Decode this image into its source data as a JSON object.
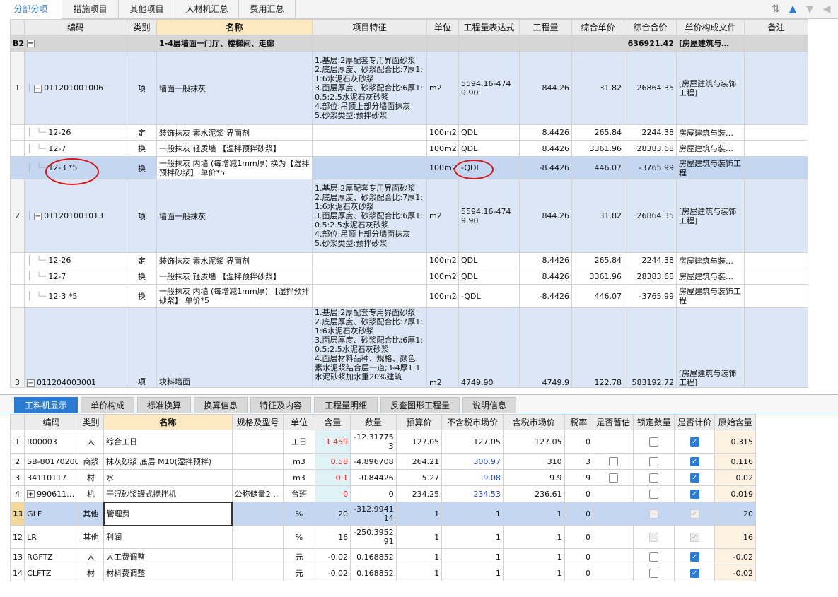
{
  "tabs": [
    "分部分项",
    "措施项目",
    "其他项目",
    "人材机汇总",
    "费用汇总"
  ],
  "top_headers": [
    "编码",
    "类别",
    "名称",
    "项目特征",
    "单位",
    "工程量表达式",
    "工程量",
    "综合单价",
    "综合合价",
    "单价构成文件",
    "备注"
  ],
  "group": {
    "no": "B2",
    "name": "1-4层墙面一门厅、楼梯间、走廊",
    "total": "636921.42",
    "file": "[房屋建筑与…"
  },
  "rows": [
    {
      "no": "1",
      "code": "011201001006",
      "type": "项",
      "name": "墙面一般抹灰",
      "feature": "1.基层:2厚配套专用界面砂浆\n2.底层厚度、砂浆配合比:7厚1:1:6水泥石灰砂浆\n3.面层厚度、砂浆配合比:6厚1:0.5:2.5水泥石灰砂浆\n4.部位:吊顶上部分墙面抹灰\n5.砂浆类型:预拌砂浆",
      "unit": "m2",
      "expr": "5594.16-4749.90",
      "qty": "844.26",
      "price": "31.82",
      "total": "26864.35",
      "file": "[房屋建筑与装饰工程]"
    },
    {
      "code": "12-26",
      "type": "定",
      "name": "装饰抹灰 素水泥浆 界面剂",
      "unit": "100m2",
      "expr": "QDL",
      "qty": "8.4426",
      "price": "265.84",
      "total": "2244.38",
      "file": "房屋建筑与装…"
    },
    {
      "code": "12-7",
      "type": "换",
      "name": "一般抹灰 轻质墙 【湿拌预拌砂浆】",
      "unit": "100m2",
      "expr": "QDL",
      "qty": "8.4426",
      "price": "3361.96",
      "total": "28383.68",
      "file": "房屋建筑与装…"
    },
    {
      "code": "12-3 *5",
      "type": "换",
      "name": "一般抹灰 内墙 (每增减1mm厚) 换为【湿拌预拌砂浆】 单价*5",
      "unit": "100m2",
      "expr": "-QDL",
      "qty": "-8.4426",
      "price": "446.07",
      "total": "-3765.99",
      "file": "房屋建筑与装饰工程"
    },
    {
      "no": "2",
      "code": "011201001013",
      "type": "项",
      "name": "墙面一般抹灰",
      "feature": "1.基层:2厚配套专用界面砂浆\n2.底层厚度、砂浆配合比:7厚1:1:6水泥石灰砂浆\n3.面层厚度、砂浆配合比:6厚1:0.5:2.5水泥石灰砂浆\n4.部位:吊顶上部分墙面抹灰\n5.砂浆类型:预拌砂浆",
      "unit": "m2",
      "expr": "5594.16-4749.90",
      "qty": "844.26",
      "price": "31.82",
      "total": "26864.35",
      "file": "[房屋建筑与装饰工程]"
    },
    {
      "code": "12-26",
      "type": "定",
      "name": "装饰抹灰 素水泥浆 界面剂",
      "unit": "100m2",
      "expr": "QDL",
      "qty": "8.4426",
      "price": "265.84",
      "total": "2244.38",
      "file": "房屋建筑与装…"
    },
    {
      "code": "12-7",
      "type": "换",
      "name": "一般抹灰 轻质墙 【湿拌预拌砂浆】",
      "unit": "100m2",
      "expr": "QDL",
      "qty": "8.4426",
      "price": "3361.96",
      "total": "28383.68",
      "file": "房屋建筑与装…"
    },
    {
      "code": "12-3 *5",
      "type": "换",
      "name": "一般抹灰 内墙 (每增减1mm厚) 【湿拌预拌砂浆】 单价*5",
      "unit": "100m2",
      "expr": "-QDL",
      "qty": "-8.4426",
      "price": "446.07",
      "total": "-3765.99",
      "file": "房屋建筑与装饰工程"
    },
    {
      "no": "3",
      "code": "011204003001",
      "type": "项",
      "name": "块料墙面",
      "feature": "1.基层:2厚配套专用界面砂浆\n2.底层厚度、砂浆配合比:7厚1:1:6水泥石灰砂浆\n3.面层厚度、砂浆配合比:6厚1:0.5:2.5水泥石灰砂浆\n4.面层材料品种、规格、颜色:素水泥浆结合层一道;3-4厚1:1水泥砂浆加水重20%建筑",
      "unit": "m2",
      "expr": "4749.90",
      "qty": "4749.9",
      "price": "122.78",
      "total": "583192.72",
      "file": "[房屋建筑与装饰工程]"
    }
  ],
  "sub_tabs": [
    "工料机显示",
    "单价构成",
    "标准换算",
    "换算信息",
    "特征及内容",
    "工程量明细",
    "反查图形工程量",
    "说明信息"
  ],
  "bot_headers": [
    "编码",
    "类别",
    "名称",
    "规格及型号",
    "单位",
    "含量",
    "数量",
    "预算价",
    "不含税市场价",
    "含税市场价",
    "税率",
    "是否暂估",
    "锁定数量",
    "是否计价",
    "原始含量"
  ],
  "bot_rows": [
    {
      "no": "1",
      "code": "R00003",
      "type": "人",
      "name": "综合工日",
      "spec": "",
      "unit": "工日",
      "content": "1.459",
      "num": "-12.317753",
      "budget": "127.05",
      "mkt": "127.05",
      "mkttax": "127.05",
      "tax": "0",
      "orig": "0.315"
    },
    {
      "no": "2",
      "code": "SB-80170200",
      "type": "商浆",
      "name": "抹灰砂浆 底层 M10(湿拌预拌)",
      "spec": "",
      "unit": "m3",
      "content": "0.58",
      "num": "-4.896708",
      "budget": "264.21",
      "mkt": "300.97",
      "mkttax": "310",
      "tax": "3",
      "orig": "0.116"
    },
    {
      "no": "3",
      "code": "34110117",
      "type": "材",
      "name": "水",
      "spec": "",
      "unit": "m3",
      "content": "0.1",
      "num": "-0.84426",
      "budget": "5.27",
      "mkt": "9.08",
      "mkttax": "9.9",
      "tax": "9",
      "orig": "0.02"
    },
    {
      "no": "4",
      "code": "990611…",
      "type": "机",
      "name": "干混砂浆罐式搅拌机",
      "spec": "公称储量2…",
      "unit": "台班",
      "content": "0",
      "num": "0",
      "budget": "234.25",
      "mkt": "234.53",
      "mkttax": "236.61",
      "tax": "0",
      "orig": "0.019"
    },
    {
      "no": "11",
      "code": "GLF",
      "type": "其他",
      "name": "管理费",
      "spec": "",
      "unit": "%",
      "content": "20",
      "num": "-312.994114",
      "budget": "1",
      "mkt": "1",
      "mkttax": "1",
      "tax": "0",
      "orig": "20"
    },
    {
      "no": "12",
      "code": "LR",
      "type": "其他",
      "name": "利润",
      "spec": "",
      "unit": "%",
      "content": "16",
      "num": "-250.395291",
      "budget": "1",
      "mkt": "1",
      "mkttax": "1",
      "tax": "0",
      "orig": "16"
    },
    {
      "no": "13",
      "code": "RGFTZ",
      "type": "人",
      "name": "人工费调整",
      "spec": "",
      "unit": "元",
      "content": "-0.02",
      "num": "0.168852",
      "budget": "1",
      "mkt": "1",
      "mkttax": "1",
      "tax": "0",
      "orig": "-0.02"
    },
    {
      "no": "14",
      "code": "CLFTZ",
      "type": "材",
      "name": "材料费调整",
      "spec": "",
      "unit": "元",
      "content": "-0.02",
      "num": "0.168852",
      "budget": "1",
      "mkt": "1",
      "mkttax": "1",
      "tax": "0",
      "orig": "-0.02"
    }
  ]
}
